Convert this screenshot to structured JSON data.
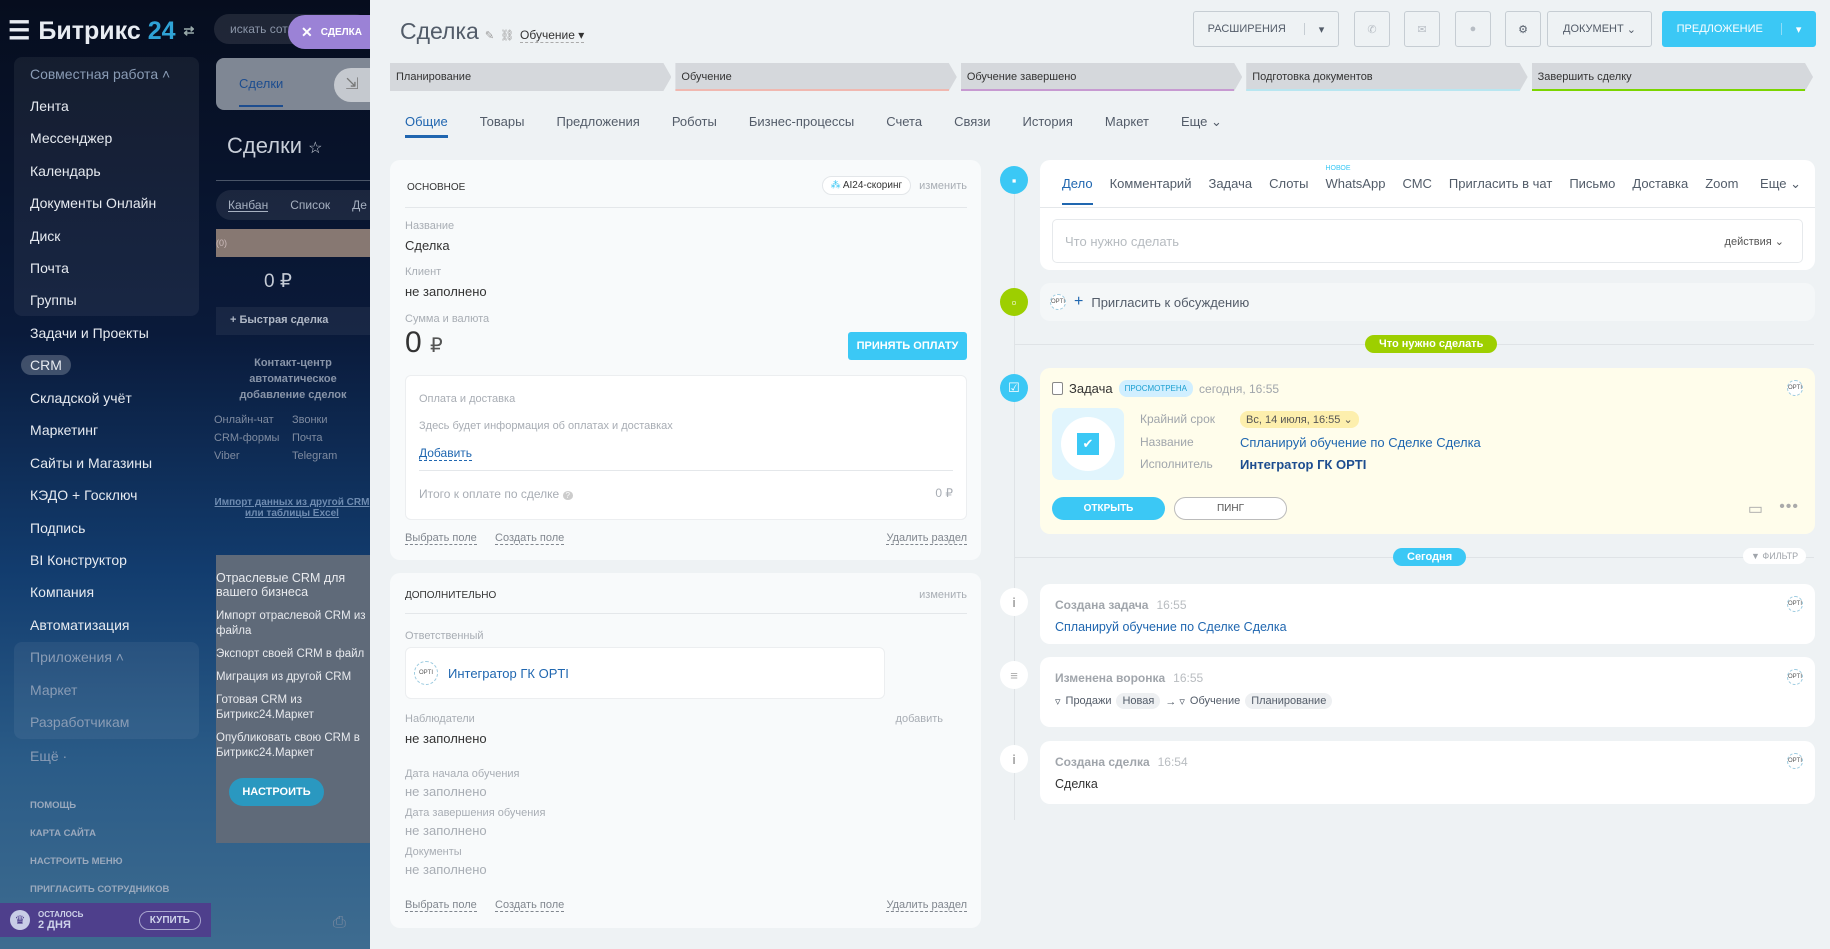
{
  "sidebar": {
    "logo_text": "Битрикс",
    "logo_num": "24",
    "group1": "Совместная работа",
    "items1": [
      "Лента",
      "Мессенджер",
      "Календарь",
      "Документы Онлайн",
      "Диск",
      "Почта",
      "Группы"
    ],
    "items2": [
      "Задачи и Проекты"
    ],
    "crm": "CRM",
    "items3": [
      "Складской учёт",
      "Маркетинг",
      "Сайты и Магазины",
      "КЭДО + Госключ",
      "Подпись",
      "BI Конструктор",
      "Компания",
      "Автоматизация"
    ],
    "group2": "Приложения",
    "items4": [
      "Маркет",
      "Разработчикам"
    ],
    "more": "Ещё ·",
    "small": [
      "помощь",
      "карта сайта",
      "настроить меню",
      "пригласить сотрудников"
    ],
    "trial_top": "ОСТАЛОСЬ",
    "trial_days": "2 ДНЯ",
    "buy": "КУПИТЬ"
  },
  "background_crm": {
    "search_placeholder": "искать сотрудника",
    "chip": "СДЕЛКА",
    "tab": "Сделки",
    "title": "Сделки",
    "views": [
      "Канбан",
      "Список",
      "Де"
    ],
    "column_count": "(0)",
    "sum": "0 ₽",
    "quick": "Быстрая сделка",
    "contact_title": "Контакт-центр",
    "contact_sub": "автоматическое добавление сделок",
    "channels": [
      "Онлайн-чат",
      "Звонки",
      "CRM-формы",
      "Почта",
      "Viber",
      "Telegram"
    ],
    "import_text": "Импорт данных из другой CRM",
    "import_text2": "или таблицы Excel",
    "promo_title": "Отраслевые CRM для вашего бизнеса",
    "promo_items": [
      "Импорт отраслевой CRM из файла",
      "Экспорт своей CRM в файл",
      "Миграция из другой CRM",
      "Готовая CRM из Битрикс24.Маркет",
      "Опубликовать свою CRM в Битрикс24.Маркет"
    ],
    "promo_button": "НАСТРОИТЬ"
  },
  "header": {
    "title": "Сделка",
    "category": "Обучение",
    "extensions": "РАСШИРЕНИЯ",
    "document": "ДОКУМЕНТ",
    "offer": "ПРЕДЛОЖЕНИЕ"
  },
  "stages": [
    {
      "name": "Планирование",
      "color": "#d5d8dc"
    },
    {
      "name": "Обучение",
      "color": "#f0b8b0"
    },
    {
      "name": "Обучение завершено",
      "color": "#c79ad1"
    },
    {
      "name": "Подготовка документов",
      "color": "#b8e6f0"
    },
    {
      "name": "Завершить сделку",
      "color": "#7bd500"
    }
  ],
  "tabs": [
    "Общие",
    "Товары",
    "Предложения",
    "Роботы",
    "Бизнес-процессы",
    "Счета",
    "Связи",
    "История",
    "Маркет",
    "Еще"
  ],
  "main_card": {
    "title": "ОСНОВНОЕ",
    "scoring": "AI24-скоринг",
    "edit": "изменить",
    "name_label": "Название",
    "name_value": "Сделка",
    "client_label": "Клиент",
    "client_value": "не заполнено",
    "sum_label": "Сумма и валюта",
    "sum_value": "0",
    "currency": "₽",
    "accept_payment": "ПРИНЯТЬ ОПЛАТУ",
    "payment_title": "Оплата и доставка",
    "payment_info": "Здесь будет информация об оплатах и доставках",
    "add": "Добавить",
    "total_label": "Итого к оплате по сделке",
    "total_value": "0 ₽",
    "select_field": "Выбрать поле",
    "create_field": "Создать поле",
    "delete_section": "Удалить раздел"
  },
  "extra_card": {
    "title": "ДОПОЛНИТЕЛЬНО",
    "edit": "изменить",
    "responsible_label": "Ответственный",
    "responsible": "Интегратор ГК OPTI",
    "observers_label": "Наблюдатели",
    "observers_add": "добавить",
    "observers_value": "не заполнено",
    "fields": [
      {
        "label": "Дата начала обучения",
        "value": "не заполнено"
      },
      {
        "label": "Дата завершения обучения",
        "value": "не заполнено"
      },
      {
        "label": "Документы",
        "value": "не заполнено"
      }
    ],
    "select_field": "Выбрать поле",
    "create_field": "Создать поле",
    "delete_section": "Удалить раздел"
  },
  "timeline": {
    "tabs": [
      "Дело",
      "Комментарий",
      "Задача",
      "Слоты",
      "WhatsApp",
      "СМС",
      "Пригласить в чат",
      "Письмо",
      "Доставка",
      "Zoom",
      "Еще"
    ],
    "new_badge": "НОВОЕ",
    "input_placeholder": "Что нужно сделать",
    "actions": "действия",
    "invite": "Пригласить к обсуждению",
    "todo_pill": "Что нужно сделать",
    "task": {
      "title": "Задача",
      "status": "ПРОСМОТРЕНА",
      "time": "сегодня, 16:55",
      "deadline_label": "Крайний срок",
      "deadline": "Вс, 14 июля, 16:55",
      "name_label": "Название",
      "name": "Спланируй обучение по Сделке Сделка",
      "executor_label": "Исполнитель",
      "executor": "Интегратор ГК OPTI",
      "open": "ОТКРЫТЬ",
      "ping": "ПИНГ"
    },
    "today_pill": "Сегодня",
    "filter": "ФИЛЬТР",
    "events": [
      {
        "title": "Создана задача",
        "time": "16:55",
        "text": "Спланируй обучение по Сделке Сделка"
      },
      {
        "title": "Изменена воронка",
        "time": "16:55",
        "from_funnel": "Продажи",
        "from_stage": "Новая",
        "to_funnel": "Обучение",
        "to_stage": "Планирование"
      },
      {
        "title": "Создана сделка",
        "time": "16:54",
        "text": "Сделка"
      }
    ]
  },
  "colors": {
    "accent": "#3bc8f5",
    "link": "#2067b0",
    "todo": "#9dcf00",
    "task_bg": "#fffdeb"
  }
}
